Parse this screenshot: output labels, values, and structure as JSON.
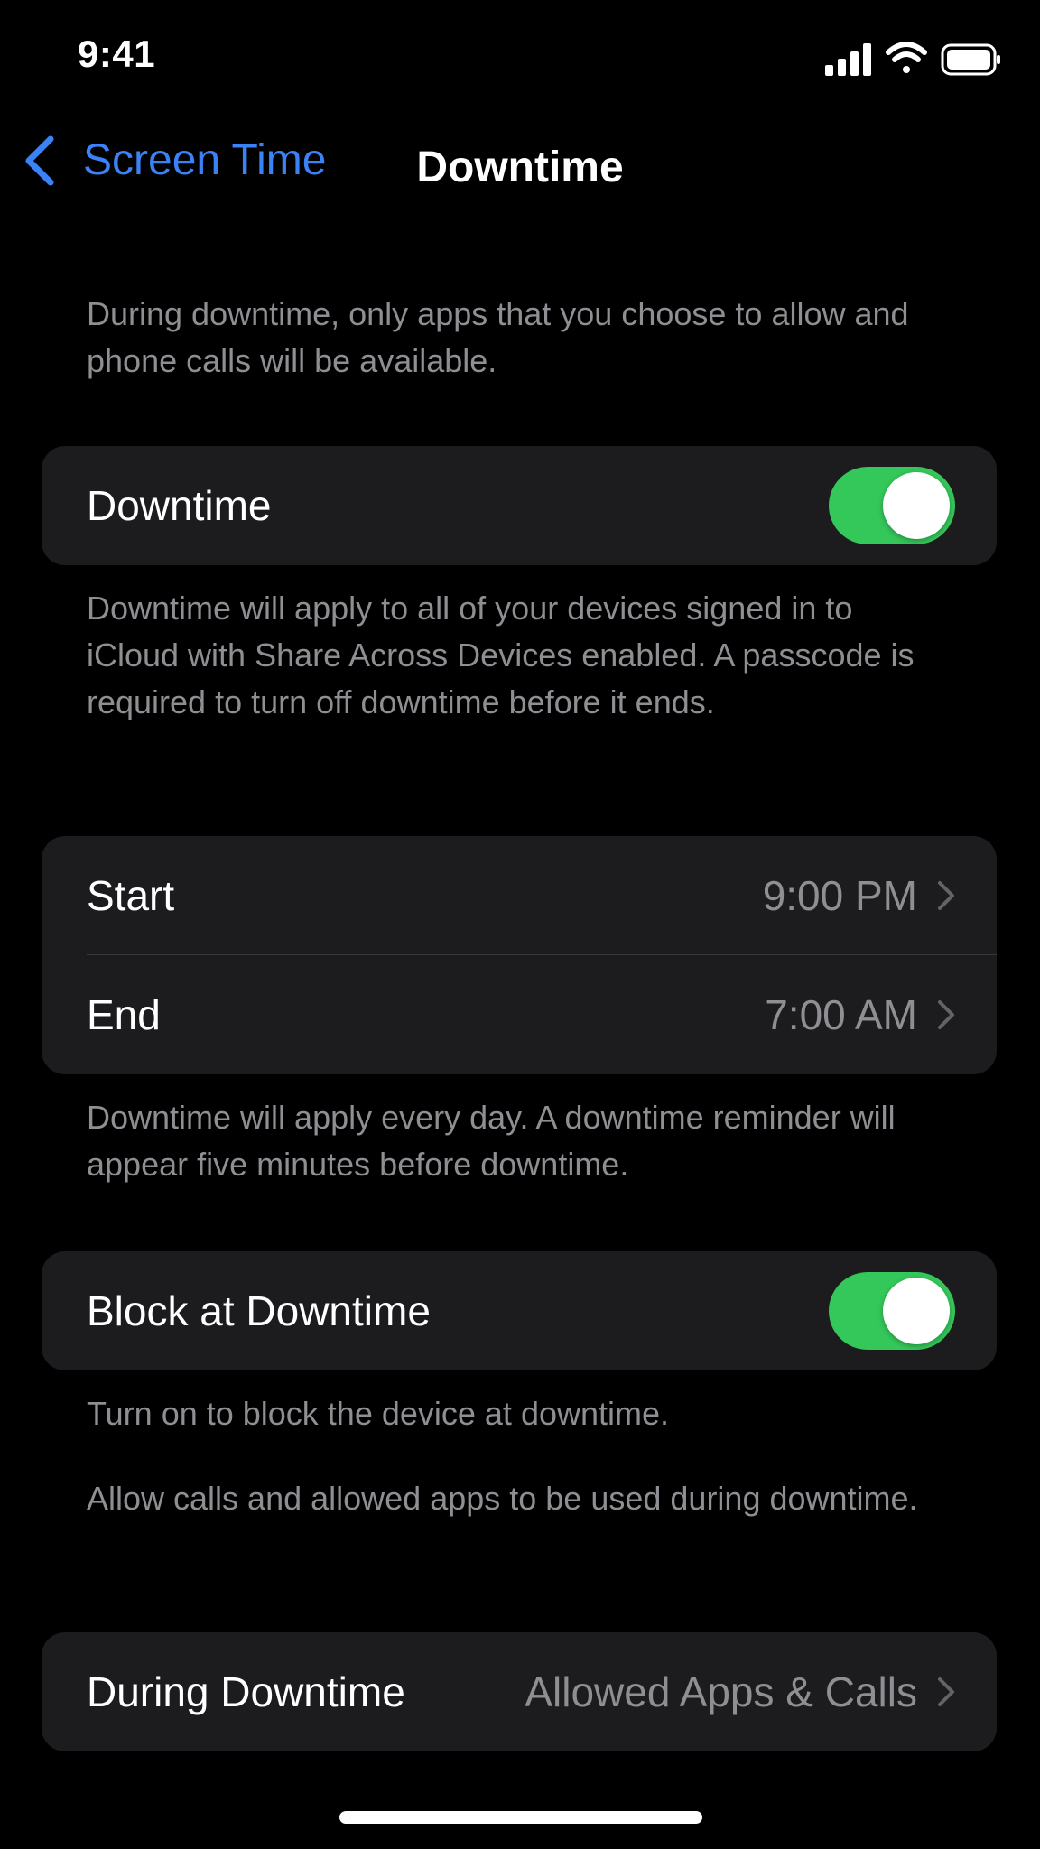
{
  "status_bar": {
    "time": "9:41",
    "icons": [
      "cellular-signal-icon",
      "wifi-icon",
      "battery-icon"
    ]
  },
  "nav": {
    "back_label": "Screen Time",
    "title": "Downtime"
  },
  "intro_note": "During downtime, only apps that you choose to allow and phone calls will be available.",
  "downtime_group": {
    "label": "Downtime",
    "enabled": true
  },
  "downtime_note": "Downtime will apply to all of your devices signed in to iCloud with Share Across Devices enabled. A passcode is required to turn off downtime before it ends.",
  "schedule": {
    "start_label": "Start",
    "start_value": "9:00 PM",
    "end_label": "End",
    "end_value": "7:00 AM"
  },
  "schedule_note": "Downtime will apply every day. A downtime reminder will appear five minutes before downtime.",
  "block_group": {
    "label": "Block at Downtime",
    "enabled": true
  },
  "block_note_on": "Turn on to block the device at downtime.",
  "block_note_allow": "Allow calls and allowed apps to be used during downtime.",
  "during": {
    "label": "During Downtime",
    "value": "Allowed Apps & Calls"
  },
  "colors": {
    "background": "#000000",
    "group_background": "#1c1c1e",
    "accent_blue": "#3b82f6",
    "toggle_on": "#34c759",
    "secondary_text": "#8e8e93"
  }
}
